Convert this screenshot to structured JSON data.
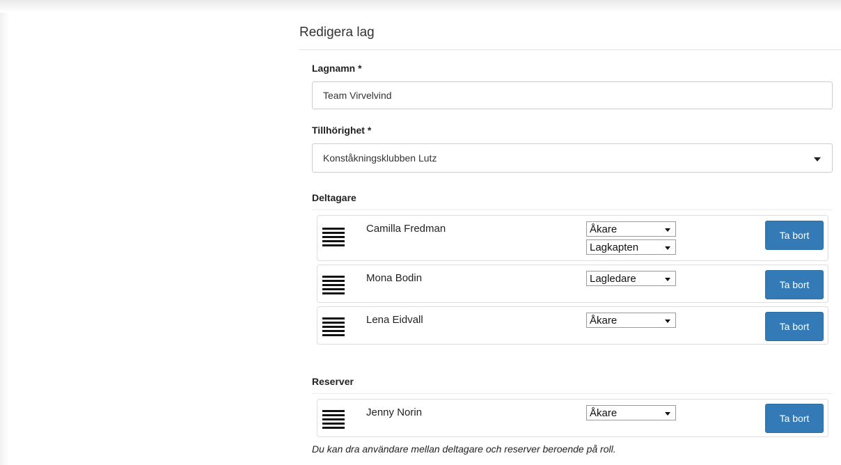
{
  "panel": {
    "title": "Redigera lag"
  },
  "team_name": {
    "label": "Lagnamn *",
    "value": "Team Virvelvind"
  },
  "affiliation": {
    "label": "Tillhörighet *",
    "value": "Konståkningsklubben Lutz"
  },
  "participants": {
    "label": "Deltagare",
    "items": [
      {
        "name": "Camilla Fredman",
        "role": "Åkare",
        "extra_role": "Lagkapten",
        "remove_label": "Ta bort"
      },
      {
        "name": "Mona Bodin",
        "role": "Lagledare",
        "remove_label": "Ta bort"
      },
      {
        "name": "Lena Eidvall",
        "role": "Åkare",
        "remove_label": "Ta bort"
      }
    ]
  },
  "reserves": {
    "label": "Reserver",
    "items": [
      {
        "name": "Jenny Norin",
        "role": "Åkare",
        "remove_label": "Ta bort"
      }
    ]
  },
  "help_text": "Du kan dra användare mellan deltagare och reserver beroende på roll.",
  "icons": {
    "drag": "drag-handle-icon",
    "dropdown": "chevron-down-icon"
  },
  "colors": {
    "button": "#337ab7",
    "button_text": "#ffffff"
  }
}
